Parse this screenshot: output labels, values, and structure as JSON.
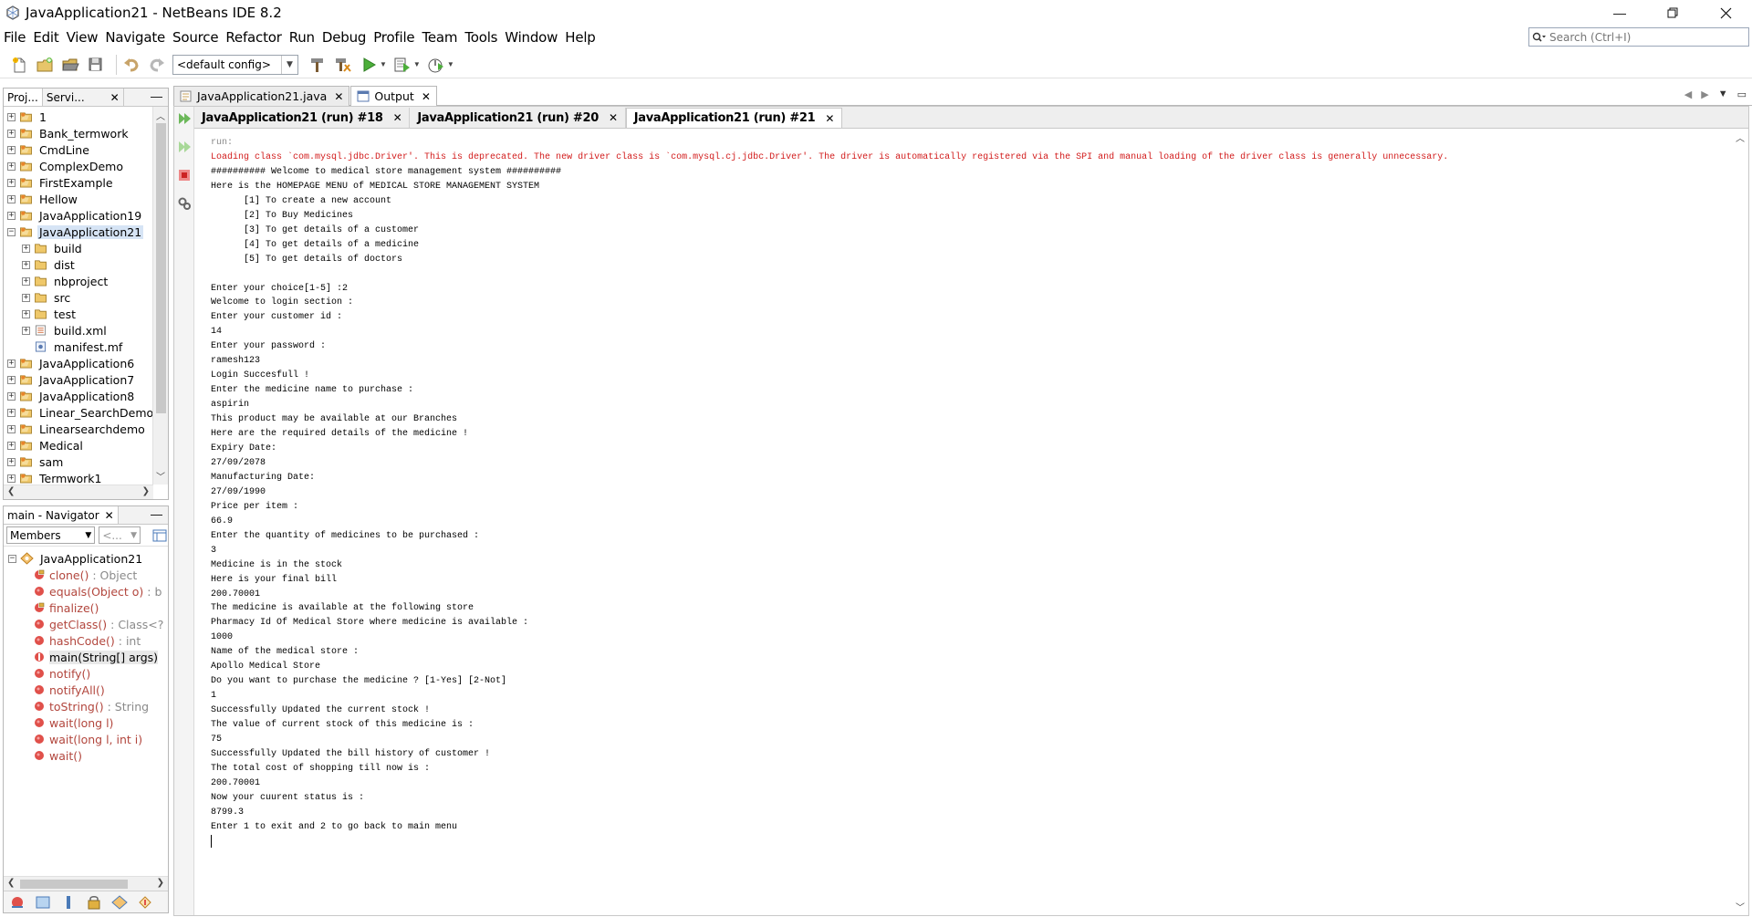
{
  "window": {
    "title": "JavaApplication21 - NetBeans IDE 8.2"
  },
  "menu": [
    "File",
    "Edit",
    "View",
    "Navigate",
    "Source",
    "Refactor",
    "Run",
    "Debug",
    "Profile",
    "Team",
    "Tools",
    "Window",
    "Help"
  ],
  "search": {
    "placeholder": "Search (Ctrl+I)"
  },
  "toolbar": {
    "config": "<default config>"
  },
  "projects_panel": {
    "tabs": [
      "Proj...",
      "Servi..."
    ],
    "items": [
      {
        "label": "1",
        "level": 0,
        "type": "project",
        "exp": "+"
      },
      {
        "label": "Bank_termwork",
        "level": 0,
        "type": "project",
        "exp": "+"
      },
      {
        "label": "CmdLine",
        "level": 0,
        "type": "project",
        "exp": "+"
      },
      {
        "label": "ComplexDemo",
        "level": 0,
        "type": "project",
        "exp": "+"
      },
      {
        "label": "FirstExample",
        "level": 0,
        "type": "project",
        "exp": "+"
      },
      {
        "label": "Hellow",
        "level": 0,
        "type": "project",
        "exp": "+"
      },
      {
        "label": "JavaApplication19",
        "level": 0,
        "type": "project",
        "exp": "+"
      },
      {
        "label": "JavaApplication21",
        "level": 0,
        "type": "project",
        "exp": "-",
        "selected": true
      },
      {
        "label": "build",
        "level": 1,
        "type": "folder",
        "exp": "+"
      },
      {
        "label": "dist",
        "level": 1,
        "type": "folder",
        "exp": "+"
      },
      {
        "label": "nbproject",
        "level": 1,
        "type": "folder",
        "exp": "+"
      },
      {
        "label": "src",
        "level": 1,
        "type": "folder",
        "exp": "+"
      },
      {
        "label": "test",
        "level": 1,
        "type": "folder",
        "exp": "+"
      },
      {
        "label": "build.xml",
        "level": 1,
        "type": "xml",
        "exp": "+"
      },
      {
        "label": "manifest.mf",
        "level": 1,
        "type": "file",
        "exp": ""
      },
      {
        "label": "JavaApplication6",
        "level": 0,
        "type": "project",
        "exp": "+"
      },
      {
        "label": "JavaApplication7",
        "level": 0,
        "type": "project",
        "exp": "+"
      },
      {
        "label": "JavaApplication8",
        "level": 0,
        "type": "project",
        "exp": "+"
      },
      {
        "label": "Linear_SearchDemo",
        "level": 0,
        "type": "project",
        "exp": "+"
      },
      {
        "label": "Linearsearchdemo",
        "level": 0,
        "type": "project",
        "exp": "+"
      },
      {
        "label": "Medical",
        "level": 0,
        "type": "project",
        "exp": "+"
      },
      {
        "label": "sam",
        "level": 0,
        "type": "project",
        "exp": "+"
      },
      {
        "label": "Termwork1",
        "level": 0,
        "type": "project",
        "exp": "+"
      }
    ]
  },
  "navigator": {
    "tab": "main - Navigator",
    "filter": "Members",
    "filter2": "<...",
    "root": "JavaApplication21",
    "methods": [
      {
        "name": "clone()",
        "ret": " : Object",
        "kind": "protected"
      },
      {
        "name": "equals(Object o)",
        "ret": " : b",
        "kind": "public"
      },
      {
        "name": "finalize()",
        "ret": "",
        "kind": "protected"
      },
      {
        "name": "getClass()",
        "ret": " : Class<?",
        "kind": "public"
      },
      {
        "name": "hashCode()",
        "ret": " : int",
        "kind": "public"
      },
      {
        "name": "main(String[] args)",
        "ret": "",
        "kind": "static",
        "selected": true
      },
      {
        "name": "notify()",
        "ret": "",
        "kind": "public"
      },
      {
        "name": "notifyAll()",
        "ret": "",
        "kind": "public"
      },
      {
        "name": "toString()",
        "ret": " : String",
        "kind": "public"
      },
      {
        "name": "wait(long l)",
        "ret": "",
        "kind": "public"
      },
      {
        "name": "wait(long l, int i)",
        "ret": "",
        "kind": "public"
      },
      {
        "name": "wait()",
        "ret": "",
        "kind": "public"
      }
    ]
  },
  "editor_tabs": [
    {
      "label": "JavaApplication21.java",
      "active": false
    },
    {
      "label": "Output",
      "active": true
    }
  ],
  "run_tabs": [
    {
      "label": "JavaApplication21 (run) #18",
      "active": false
    },
    {
      "label": "JavaApplication21 (run) #20",
      "active": false
    },
    {
      "label": "JavaApplication21 (run) #21",
      "active": true
    }
  ],
  "console": [
    {
      "text": "run:",
      "style": "gray"
    },
    {
      "text": "Loading class `com.mysql.jdbc.Driver'. This is deprecated. The new driver class is `com.mysql.cj.jdbc.Driver'. The driver is automatically registered via the SPI and manual loading of the driver class is generally unnecessary.",
      "style": "red"
    },
    {
      "text": "########## Welcome to medical store management system ##########"
    },
    {
      "text": "Here is the HOMEPAGE MENU of MEDICAL STORE MANAGEMENT SYSTEM"
    },
    {
      "text": "\t[1] To create a new account"
    },
    {
      "text": "\t[2] To Buy Medicines"
    },
    {
      "text": "\t[3] To get details of a customer"
    },
    {
      "text": "\t[4] To get details of a medicine"
    },
    {
      "text": "\t[5] To get details of doctors"
    },
    {
      "text": ""
    },
    {
      "text": "Enter your choice[1-5] :2"
    },
    {
      "text": "Welcome to login section :"
    },
    {
      "text": "Enter your customer id :"
    },
    {
      "text": "14"
    },
    {
      "text": "Enter your password :"
    },
    {
      "text": "ramesh123"
    },
    {
      "text": "Login Succesfull !"
    },
    {
      "text": "Enter the medicine name to purchase :"
    },
    {
      "text": "aspirin"
    },
    {
      "text": "This product may be available at our Branches"
    },
    {
      "text": "Here are the required details of the medicine !"
    },
    {
      "text": "Expiry Date:"
    },
    {
      "text": "27/09/2078"
    },
    {
      "text": "Manufacturing Date:"
    },
    {
      "text": "27/09/1990"
    },
    {
      "text": "Price per item :"
    },
    {
      "text": "66.9"
    },
    {
      "text": "Enter the quantity of medicines to be purchased :"
    },
    {
      "text": "3"
    },
    {
      "text": "Medicine is in the stock"
    },
    {
      "text": "Here is your final bill"
    },
    {
      "text": "200.70001"
    },
    {
      "text": "The medicine is available at the following store"
    },
    {
      "text": "Pharmacy Id Of Medical Store where medicine is available :"
    },
    {
      "text": "1000"
    },
    {
      "text": "Name of the medical store :"
    },
    {
      "text": "Apollo Medical Store"
    },
    {
      "text": "Do you want to purchase the medicine ? [1-Yes] [2-Not]"
    },
    {
      "text": "1"
    },
    {
      "text": "Successfully Updated the current stock !"
    },
    {
      "text": "The value of current stock of this medicine is :"
    },
    {
      "text": "75"
    },
    {
      "text": "Successfully Updated the bill history of customer !"
    },
    {
      "text": "The total cost of shopping till now is :"
    },
    {
      "text": "200.70001"
    },
    {
      "text": "Now your cuurent status is :"
    },
    {
      "text": "8799.3"
    },
    {
      "text": "Enter 1 to exit and 2 to go back to main menu"
    }
  ],
  "colors": {
    "error_text": "#d21b1b",
    "method_text": "#b2463d",
    "selection": "#d6e4f5"
  }
}
